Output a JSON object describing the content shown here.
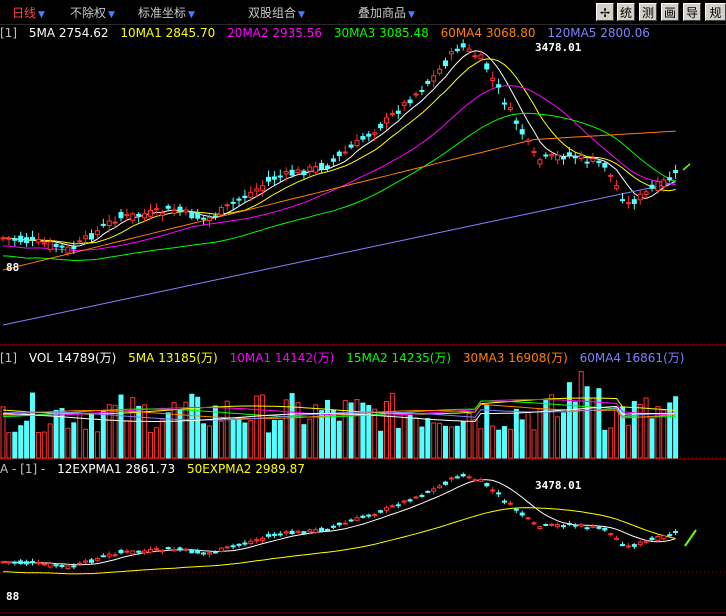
{
  "toolbar": {
    "menus": [
      {
        "label": "日线",
        "active": true
      },
      {
        "label": "不除权",
        "active": false
      },
      {
        "label": "标准坐标",
        "active": false
      },
      {
        "label": "双股组合",
        "active": false
      },
      {
        "label": "叠加商品",
        "active": false
      }
    ],
    "buttons": [
      "✢",
      "统",
      "测",
      "画",
      "导",
      "规"
    ]
  },
  "main_panel": {
    "prefix": "[1]",
    "ma": [
      {
        "label": "5MA",
        "value": "2754.62",
        "color": "#ffffff"
      },
      {
        "label": "10MA1",
        "value": "2845.70",
        "color": "#ffff00"
      },
      {
        "label": "20MA2",
        "value": "2935.56",
        "color": "#ff00ff"
      },
      {
        "label": "30MA3",
        "value": "3085.48",
        "color": "#00ff00"
      },
      {
        "label": "60MA4",
        "value": "3068.80",
        "color": "#ff8000"
      },
      {
        "label": "120MA5",
        "value": "2800.06",
        "color": "#8080ff"
      }
    ],
    "high_label": "3478.01",
    "low_label": "88"
  },
  "volume_panel": {
    "prefix": "[1]",
    "vol": {
      "label": "VOL",
      "value": "14789(万)",
      "color": "#ffffff"
    },
    "ma": [
      {
        "label": "5MA",
        "value": "13185(万)",
        "color": "#ffff00"
      },
      {
        "label": "10MA1",
        "value": "14142(万)",
        "color": "#ff00ff"
      },
      {
        "label": "15MA2",
        "value": "14235(万)",
        "color": "#00ff00"
      },
      {
        "label": "30MA3",
        "value": "16908(万)",
        "color": "#ff8000"
      },
      {
        "label": "60MA4",
        "value": "16861(万)",
        "color": "#8080ff"
      }
    ]
  },
  "expma_panel": {
    "prefix": "A - [1] -",
    "ema": [
      {
        "label": "12EXPMA1",
        "value": "2861.73",
        "color": "#ffffff"
      },
      {
        "label": "50EXPMA2",
        "value": "2989.87",
        "color": "#ffff00"
      }
    ],
    "high_label": "3478.01",
    "low_label": "88"
  },
  "colors": {
    "up": "#ff3232",
    "down": "#54ffff",
    "background": "#000000",
    "grid": "#8b0000"
  }
}
